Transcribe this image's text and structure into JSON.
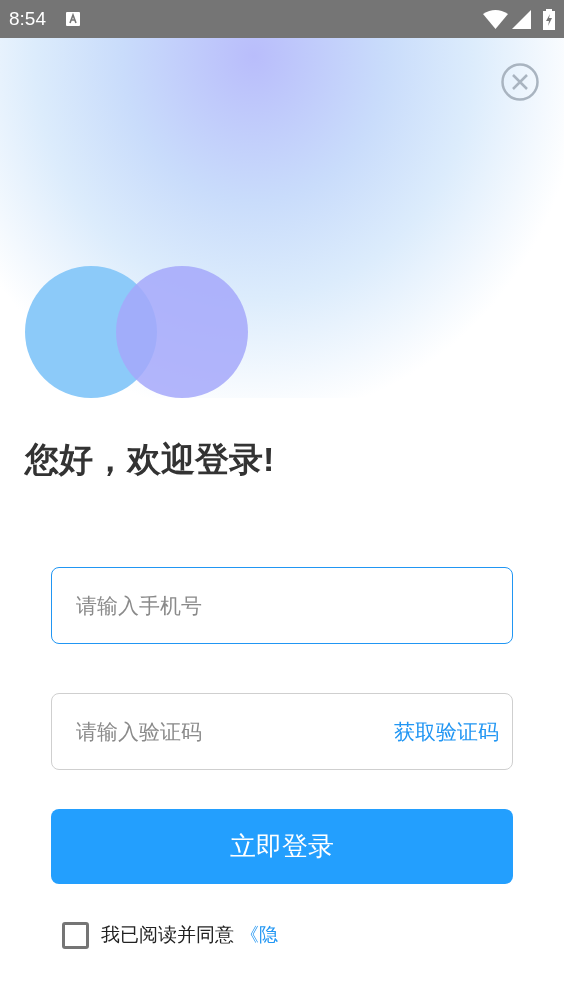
{
  "status_bar": {
    "time": "8:54"
  },
  "greeting": "您好，欢迎登录!",
  "phone_field": {
    "placeholder": "请输入手机号",
    "focused": true
  },
  "code_field": {
    "placeholder": "请输入验证码",
    "focused": false,
    "action": "获取验证码"
  },
  "login_button": {
    "label": "立即登录"
  },
  "agreement": {
    "checked": false,
    "text": "我已阅读并同意",
    "link": "《隐"
  }
}
